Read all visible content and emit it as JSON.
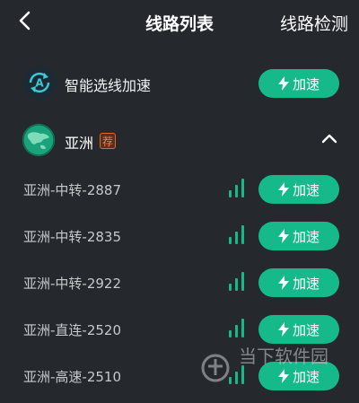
{
  "header": {
    "title": "线路列表",
    "detect_label": "线路检测"
  },
  "smart": {
    "label": "智能选线加速",
    "button_label": "加速"
  },
  "region": {
    "name": "亚洲",
    "badge": "荐"
  },
  "lines": [
    {
      "name": "亚洲-中转-2887",
      "button_label": "加速"
    },
    {
      "name": "亚洲-中转-2835",
      "button_label": "加速"
    },
    {
      "name": "亚洲-中转-2922",
      "button_label": "加速"
    },
    {
      "name": "亚洲-直连-2520",
      "button_label": "加速"
    },
    {
      "name": "亚洲-高速-2510",
      "button_label": "加速"
    }
  ],
  "watermark": {
    "text": "当下软件园"
  },
  "colors": {
    "background": "#25292e",
    "accent": "#16b98a",
    "badge": "#ff7a3a"
  }
}
